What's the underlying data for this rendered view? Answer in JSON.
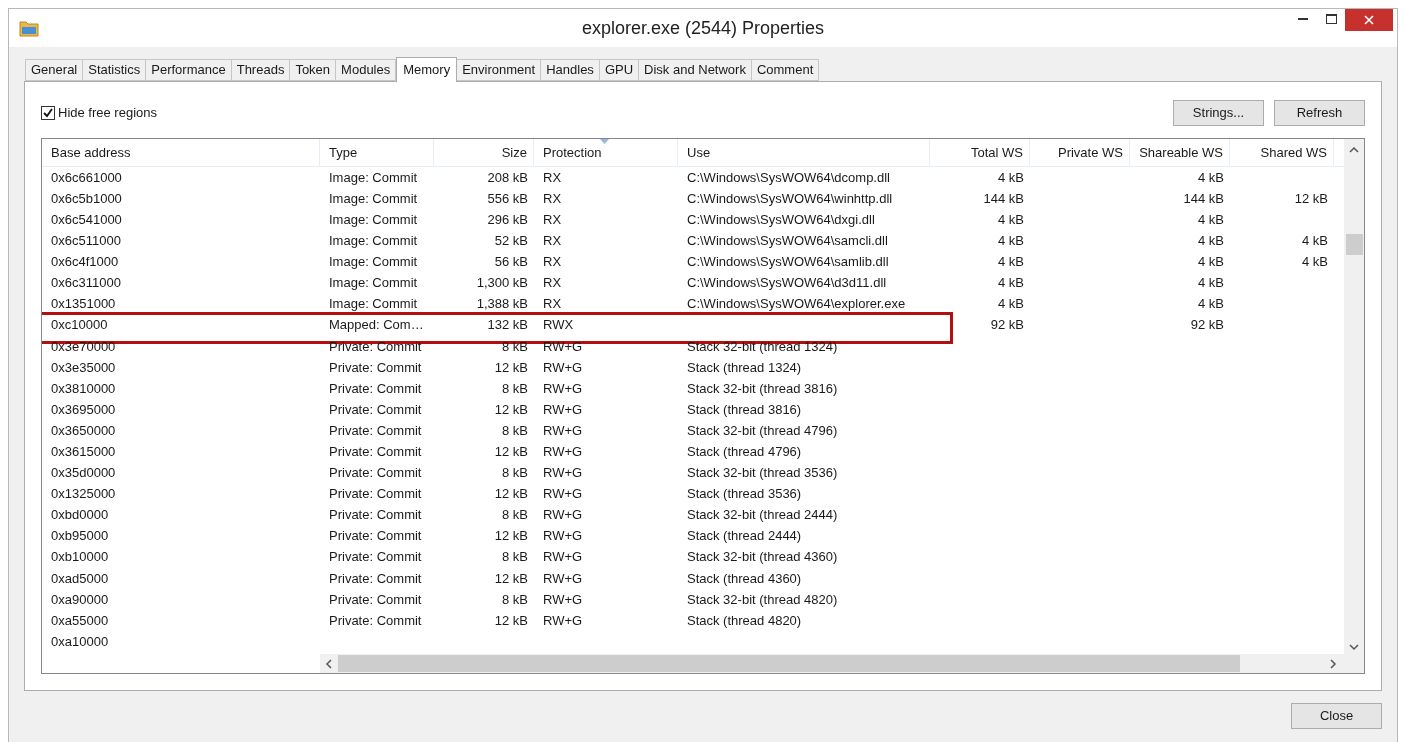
{
  "window": {
    "title": "explorer.exe (2544) Properties"
  },
  "tabs": [
    {
      "label": "General",
      "selected": false
    },
    {
      "label": "Statistics",
      "selected": false
    },
    {
      "label": "Performance",
      "selected": false
    },
    {
      "label": "Threads",
      "selected": false
    },
    {
      "label": "Token",
      "selected": false
    },
    {
      "label": "Modules",
      "selected": false
    },
    {
      "label": "Memory",
      "selected": true
    },
    {
      "label": "Environment",
      "selected": false
    },
    {
      "label": "Handles",
      "selected": false
    },
    {
      "label": "GPU",
      "selected": false
    },
    {
      "label": "Disk and Network",
      "selected": false
    },
    {
      "label": "Comment",
      "selected": false
    }
  ],
  "hide_free_regions": {
    "label": "Hide free regions",
    "checked": true
  },
  "buttons": [
    "Strings...",
    "Refresh"
  ],
  "table": {
    "columns": [
      {
        "label": "Base address",
        "sorted": false
      },
      {
        "label": "Type",
        "sorted": false
      },
      {
        "label": "Size",
        "sorted": false
      },
      {
        "label": "Protection",
        "sorted": true
      },
      {
        "label": "Use",
        "sorted": false
      },
      {
        "label": "Total WS",
        "sorted": false
      },
      {
        "label": "Private WS",
        "sorted": false
      },
      {
        "label": "Shareable WS",
        "sorted": false
      },
      {
        "label": "Shared WS",
        "sorted": false
      }
    ],
    "rows": [
      {
        "highlighted": false,
        "cells": [
          "0x6c661000",
          "Image: Commit",
          "208 kB",
          "RX",
          "C:\\Windows\\SysWOW64\\dcomp.dll",
          "4 kB",
          "",
          "4 kB",
          ""
        ]
      },
      {
        "highlighted": false,
        "cells": [
          "0x6c5b1000",
          "Image: Commit",
          "556 kB",
          "RX",
          "C:\\Windows\\SysWOW64\\winhttp.dll",
          "144 kB",
          "",
          "144 kB",
          "12 kB"
        ]
      },
      {
        "highlighted": false,
        "cells": [
          "0x6c541000",
          "Image: Commit",
          "296 kB",
          "RX",
          "C:\\Windows\\SysWOW64\\dxgi.dll",
          "4 kB",
          "",
          "4 kB",
          ""
        ]
      },
      {
        "highlighted": false,
        "cells": [
          "0x6c511000",
          "Image: Commit",
          "52 kB",
          "RX",
          "C:\\Windows\\SysWOW64\\samcli.dll",
          "4 kB",
          "",
          "4 kB",
          "4 kB"
        ]
      },
      {
        "highlighted": false,
        "cells": [
          "0x6c4f1000",
          "Image: Commit",
          "56 kB",
          "RX",
          "C:\\Windows\\SysWOW64\\samlib.dll",
          "4 kB",
          "",
          "4 kB",
          "4 kB"
        ]
      },
      {
        "highlighted": false,
        "cells": [
          "0x6c311000",
          "Image: Commit",
          "1,300 kB",
          "RX",
          "C:\\Windows\\SysWOW64\\d3d11.dll",
          "4 kB",
          "",
          "4 kB",
          ""
        ]
      },
      {
        "highlighted": false,
        "cells": [
          "0x1351000",
          "Image: Commit",
          "1,388 kB",
          "RX",
          "C:\\Windows\\SysWOW64\\explorer.exe",
          "4 kB",
          "",
          "4 kB",
          ""
        ]
      },
      {
        "highlighted": true,
        "cells": [
          "0xc10000",
          "Mapped: Com…",
          "132 kB",
          "RWX",
          "",
          "92 kB",
          "",
          "92 kB",
          ""
        ]
      },
      {
        "highlighted": false,
        "cells": [
          "0x3e70000",
          "Private: Commit",
          "8 kB",
          "RW+G",
          "Stack 32-bit (thread 1324)",
          "",
          "",
          "",
          ""
        ]
      },
      {
        "highlighted": false,
        "cells": [
          "0x3e35000",
          "Private: Commit",
          "12 kB",
          "RW+G",
          "Stack (thread 1324)",
          "",
          "",
          "",
          ""
        ]
      },
      {
        "highlighted": false,
        "cells": [
          "0x3810000",
          "Private: Commit",
          "8 kB",
          "RW+G",
          "Stack 32-bit (thread 3816)",
          "",
          "",
          "",
          ""
        ]
      },
      {
        "highlighted": false,
        "cells": [
          "0x3695000",
          "Private: Commit",
          "12 kB",
          "RW+G",
          "Stack (thread 3816)",
          "",
          "",
          "",
          ""
        ]
      },
      {
        "highlighted": false,
        "cells": [
          "0x3650000",
          "Private: Commit",
          "8 kB",
          "RW+G",
          "Stack 32-bit (thread 4796)",
          "",
          "",
          "",
          ""
        ]
      },
      {
        "highlighted": false,
        "cells": [
          "0x3615000",
          "Private: Commit",
          "12 kB",
          "RW+G",
          "Stack (thread 4796)",
          "",
          "",
          "",
          ""
        ]
      },
      {
        "highlighted": false,
        "cells": [
          "0x35d0000",
          "Private: Commit",
          "8 kB",
          "RW+G",
          "Stack 32-bit (thread 3536)",
          "",
          "",
          "",
          ""
        ]
      },
      {
        "highlighted": false,
        "cells": [
          "0x1325000",
          "Private: Commit",
          "12 kB",
          "RW+G",
          "Stack (thread 3536)",
          "",
          "",
          "",
          ""
        ]
      },
      {
        "highlighted": false,
        "cells": [
          "0xbd0000",
          "Private: Commit",
          "8 kB",
          "RW+G",
          "Stack 32-bit (thread 2444)",
          "",
          "",
          "",
          ""
        ]
      },
      {
        "highlighted": false,
        "cells": [
          "0xb95000",
          "Private: Commit",
          "12 kB",
          "RW+G",
          "Stack (thread 2444)",
          "",
          "",
          "",
          ""
        ]
      },
      {
        "highlighted": false,
        "cells": [
          "0xb10000",
          "Private: Commit",
          "8 kB",
          "RW+G",
          "Stack 32-bit (thread 4360)",
          "",
          "",
          "",
          ""
        ]
      },
      {
        "highlighted": false,
        "cells": [
          "0xad5000",
          "Private: Commit",
          "12 kB",
          "RW+G",
          "Stack (thread 4360)",
          "",
          "",
          "",
          ""
        ]
      },
      {
        "highlighted": false,
        "cells": [
          "0xa90000",
          "Private: Commit",
          "8 kB",
          "RW+G",
          "Stack 32-bit (thread 4820)",
          "",
          "",
          "",
          ""
        ]
      },
      {
        "highlighted": false,
        "cells": [
          "0xa55000",
          "Private: Commit",
          "12 kB",
          "RW+G",
          "Stack (thread 4820)",
          "",
          "",
          "",
          ""
        ]
      },
      {
        "highlighted": false,
        "cells": [
          "0xa10000",
          "",
          "",
          "",
          "",
          "",
          "",
          "",
          ""
        ]
      }
    ]
  },
  "close_button": "Close"
}
